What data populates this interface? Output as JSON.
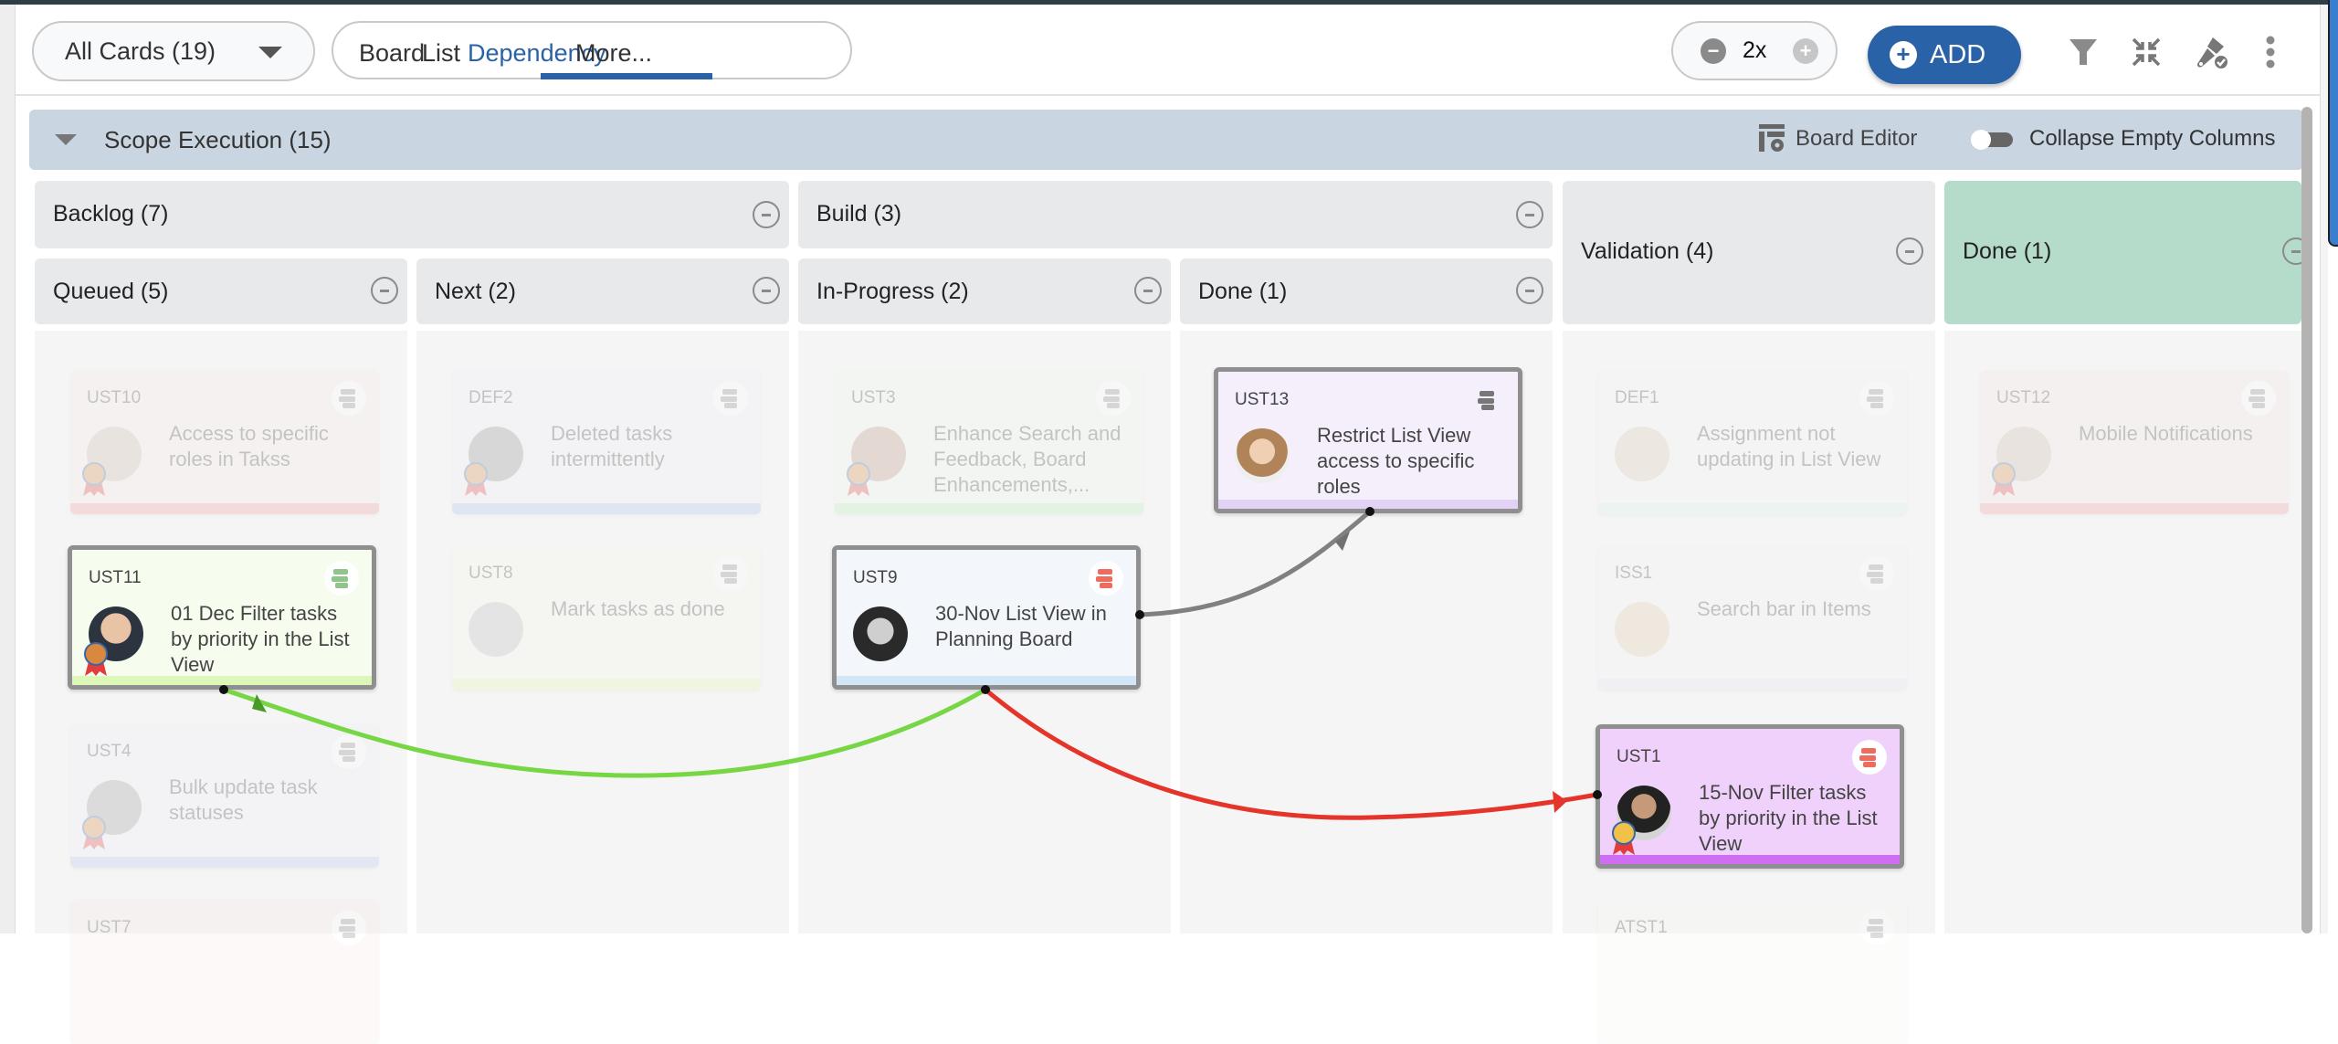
{
  "toolbar": {
    "cards_filter": "All Cards (19)",
    "tabs": [
      "Board",
      "List",
      "Dependency",
      "More..."
    ],
    "active_tab": "Dependency",
    "zoom_level": "2x",
    "zoom_out_symbol": "−",
    "zoom_in_symbol": "+",
    "add_label": "ADD",
    "add_symbol": "+",
    "icons": [
      "filter-icon",
      "collapse-icon",
      "paint-brush-check-icon",
      "more-vertical-icon"
    ]
  },
  "scope": {
    "title": "Scope Execution  (15)",
    "board_editor": "Board Editor",
    "collapse_empty_columns": "Collapse Empty Columns",
    "collapse_empty_columns_on": false
  },
  "groups": {
    "backlog": "Backlog  (7)",
    "build": "Build  (3)",
    "validation": "Validation  (4)",
    "done": "Done  (1)"
  },
  "columns": {
    "queued": "Queued  (5)",
    "next": "Next  (2)",
    "in_progress": "In-Progress  (2)",
    "build_done": "Done  (1)"
  },
  "colors": {
    "accent": "#2a62a8",
    "done_group": "#b5dccb",
    "link_gray": "#808080",
    "link_green": "#77d644",
    "link_red": "#e5352a"
  },
  "cards": {
    "ust10": {
      "id": "UST10",
      "title": "Access to specific roles in Takss"
    },
    "ust11": {
      "id": "UST11",
      "title": "01 Dec Filter tasks by priority in the List View"
    },
    "ust4": {
      "id": "UST4",
      "title": "Bulk update task statuses"
    },
    "ust7": {
      "id": "UST7",
      "title": ""
    },
    "def2": {
      "id": "DEF2",
      "title": "Deleted tasks intermittently"
    },
    "ust8": {
      "id": "UST8",
      "title": "Mark tasks as done"
    },
    "ust3": {
      "id": "UST3",
      "title": "Enhance Search and Feedback, Board Enhancements,..."
    },
    "ust9": {
      "id": "UST9",
      "title": "30-Nov List View in Planning Board"
    },
    "ust13": {
      "id": "UST13",
      "title": "Restrict List View access to specific roles"
    },
    "def1": {
      "id": "DEF1",
      "title": "Assignment not updating in List View"
    },
    "iss1": {
      "id": "ISS1",
      "title": "Search bar in Items"
    },
    "ust1": {
      "id": "UST1",
      "title": "15-Nov Filter tasks by priority in the List View"
    },
    "atst1": {
      "id": "ATST1",
      "title": ""
    },
    "ust12": {
      "id": "UST12",
      "title": "Mobile Notifications"
    }
  },
  "dependencies": [
    {
      "from": "UST9",
      "to": "UST13",
      "color": "gray"
    },
    {
      "from": "UST9",
      "to": "UST11",
      "color": "green"
    },
    {
      "from": "UST9",
      "to": "UST1",
      "color": "red"
    }
  ]
}
